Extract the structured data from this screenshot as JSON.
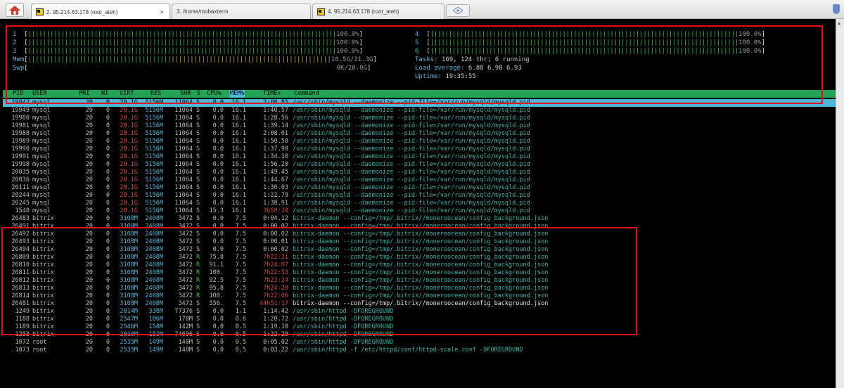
{
  "tabs": [
    {
      "label": "2. 95.214.63.178 (root_ateh)",
      "active": true,
      "has_close": true
    },
    {
      "label": "3. /home/mobaxterm",
      "active": false
    },
    {
      "label": "4. 95.214.63.178 (root_ateh)",
      "active": false
    }
  ],
  "tab_close": "×",
  "cpu_meters": [
    {
      "id": "1",
      "pct": "100.0%"
    },
    {
      "id": "2",
      "pct": "100.0%"
    },
    {
      "id": "3",
      "pct": "100.0%"
    },
    {
      "id": "4",
      "pct": "100.0%"
    },
    {
      "id": "5",
      "pct": "100.0%"
    },
    {
      "id": "6",
      "pct": "100.0%"
    }
  ],
  "mem": {
    "label": "Mem",
    "value": "10.5G/31.3G"
  },
  "swp": {
    "label": "Swp",
    "value": "0K/20.0G"
  },
  "tasks": {
    "label": "Tasks:",
    "text": "169, 124 thr; 6 running"
  },
  "load": {
    "label": "Load average:",
    "text": "6.88 6.98 6.93"
  },
  "uptime": {
    "label": "Uptime:",
    "text": "19:35:55"
  },
  "columns": {
    "pid": "PID",
    "user": "USER",
    "pri": "PRI",
    "ni": "NI",
    "virt": "VIRT",
    "res": "RES",
    "shr": "SHR",
    "s": "S",
    "cpu": "CPU%",
    "mem": "MEM%",
    "time": "TIME+",
    "cmd": "Command"
  },
  "processes": [
    {
      "pid": "19942",
      "user": "mysql",
      "pri": "20",
      "ni": "0",
      "virt": "20.1G",
      "res": "5156M",
      "shr": "11064",
      "s": "S",
      "cpu": "0.0",
      "mem": "16.1",
      "time": "2:00.85",
      "cmd": "/usr/sbin/mysqld --daemonize --pid-file=/var/run/mysqld/mysqld.pid"
    },
    {
      "pid": "19949",
      "user": "mysql",
      "pri": "20",
      "ni": "0",
      "virt": "20.1G",
      "res": "5156M",
      "shr": "11064",
      "s": "S",
      "cpu": "0.0",
      "mem": "16.1",
      "time": "1:40.57",
      "cmd": "/usr/sbin/mysqld --daemonize --pid-file=/var/run/mysqld/mysqld.pid"
    },
    {
      "pid": "19980",
      "user": "mysql",
      "pri": "20",
      "ni": "0",
      "virt": "20.1G",
      "res": "5156M",
      "shr": "11064",
      "s": "S",
      "cpu": "0.0",
      "mem": "16.1",
      "time": "1:28.56",
      "cmd": "/usr/sbin/mysqld --daemonize --pid-file=/var/run/mysqld/mysqld.pid"
    },
    {
      "pid": "19981",
      "user": "mysql",
      "pri": "20",
      "ni": "0",
      "virt": "20.1G",
      "res": "5156M",
      "shr": "11064",
      "s": "S",
      "cpu": "0.0",
      "mem": "16.1",
      "time": "1:39.14",
      "cmd": "/usr/sbin/mysqld --daemonize --pid-file=/var/run/mysqld/mysqld.pid"
    },
    {
      "pid": "19988",
      "user": "mysql",
      "pri": "20",
      "ni": "0",
      "virt": "20.1G",
      "res": "5156M",
      "shr": "11064",
      "s": "S",
      "cpu": "0.0",
      "mem": "16.1",
      "time": "2:08.01",
      "cmd": "/usr/sbin/mysqld --daemonize --pid-file=/var/run/mysqld/mysqld.pid"
    },
    {
      "pid": "19989",
      "user": "mysql",
      "pri": "20",
      "ni": "0",
      "virt": "20.1G",
      "res": "5156M",
      "shr": "11064",
      "s": "S",
      "cpu": "0.0",
      "mem": "16.1",
      "time": "1:50.58",
      "cmd": "/usr/sbin/mysqld --daemonize --pid-file=/var/run/mysqld/mysqld.pid"
    },
    {
      "pid": "19990",
      "user": "mysql",
      "pri": "20",
      "ni": "0",
      "virt": "20.1G",
      "res": "5156M",
      "shr": "11064",
      "s": "S",
      "cpu": "0.0",
      "mem": "16.1",
      "time": "1:37.98",
      "cmd": "/usr/sbin/mysqld --daemonize --pid-file=/var/run/mysqld/mysqld.pid"
    },
    {
      "pid": "19991",
      "user": "mysql",
      "pri": "20",
      "ni": "0",
      "virt": "20.1G",
      "res": "5156M",
      "shr": "11064",
      "s": "S",
      "cpu": "0.0",
      "mem": "16.1",
      "time": "1:34.10",
      "cmd": "/usr/sbin/mysqld --daemonize --pid-file=/var/run/mysqld/mysqld.pid"
    },
    {
      "pid": "19998",
      "user": "mysql",
      "pri": "20",
      "ni": "0",
      "virt": "20.1G",
      "res": "5156M",
      "shr": "11064",
      "s": "S",
      "cpu": "0.0",
      "mem": "16.1",
      "time": "1:56.20",
      "cmd": "/usr/sbin/mysqld --daemonize --pid-file=/var/run/mysqld/mysqld.pid"
    },
    {
      "pid": "20035",
      "user": "mysql",
      "pri": "20",
      "ni": "0",
      "virt": "20.1G",
      "res": "5156M",
      "shr": "11064",
      "s": "S",
      "cpu": "0.0",
      "mem": "16.1",
      "time": "1:49.45",
      "cmd": "/usr/sbin/mysqld --daemonize --pid-file=/var/run/mysqld/mysqld.pid"
    },
    {
      "pid": "20036",
      "user": "mysql",
      "pri": "20",
      "ni": "0",
      "virt": "20.1G",
      "res": "5156M",
      "shr": "11064",
      "s": "S",
      "cpu": "0.0",
      "mem": "16.1",
      "time": "1:44.67",
      "cmd": "/usr/sbin/mysqld --daemonize --pid-file=/var/run/mysqld/mysqld.pid"
    },
    {
      "pid": "20111",
      "user": "mysql",
      "pri": "20",
      "ni": "0",
      "virt": "20.1G",
      "res": "5156M",
      "shr": "11064",
      "s": "S",
      "cpu": "0.0",
      "mem": "16.1",
      "time": "1:30.03",
      "cmd": "/usr/sbin/mysqld --daemonize --pid-file=/var/run/mysqld/mysqld.pid"
    },
    {
      "pid": "20244",
      "user": "mysql",
      "pri": "20",
      "ni": "0",
      "virt": "20.1G",
      "res": "5156M",
      "shr": "11064",
      "s": "S",
      "cpu": "0.0",
      "mem": "16.1",
      "time": "1:22.79",
      "cmd": "/usr/sbin/mysqld --daemonize --pid-file=/var/run/mysqld/mysqld.pid"
    },
    {
      "pid": "20245",
      "user": "mysql",
      "pri": "20",
      "ni": "0",
      "virt": "20.1G",
      "res": "5156M",
      "shr": "11064",
      "s": "S",
      "cpu": "0.0",
      "mem": "16.1",
      "time": "1:38.91",
      "cmd": "/usr/sbin/mysqld --daemonize --pid-file=/var/run/mysqld/mysqld.pid"
    },
    {
      "pid": "1548",
      "user": "mysql",
      "pri": "20",
      "ni": "0",
      "virt": "20.1G",
      "res": "5156M",
      "shr": "11064",
      "s": "S",
      "cpu": "15.3",
      "mem": "16.1",
      "time": "3h58:18",
      "cmd": "/usr/sbin/mysqld --daemonize --pid-file=/var/run/mysqld/mysqld.pid"
    },
    {
      "pid": "26483",
      "user": "bitrix",
      "pri": "20",
      "ni": "0",
      "virt": "3108M",
      "res": "2408M",
      "shr": "3472",
      "s": "S",
      "cpu": "0.0",
      "mem": "7.5",
      "time": "0:04.12",
      "cmd": "bitrix-daemon --config=/tmp/.bitrix//moneroocean/config_background.json"
    },
    {
      "pid": "26491",
      "user": "bitrix",
      "pri": "20",
      "ni": "0",
      "virt": "3108M",
      "res": "2408M",
      "shr": "3472",
      "s": "S",
      "cpu": "0.0",
      "mem": "7.5",
      "time": "0:00.02",
      "cmd": "bitrix-daemon --config=/tmp/.bitrix//moneroocean/config_background.json"
    },
    {
      "pid": "26492",
      "user": "bitrix",
      "pri": "20",
      "ni": "0",
      "virt": "3108M",
      "res": "2408M",
      "shr": "3472",
      "s": "S",
      "cpu": "0.0",
      "mem": "7.5",
      "time": "0:00.02",
      "cmd": "bitrix-daemon --config=/tmp/.bitrix//moneroocean/config_background.json"
    },
    {
      "pid": "26493",
      "user": "bitrix",
      "pri": "20",
      "ni": "0",
      "virt": "3108M",
      "res": "2408M",
      "shr": "3472",
      "s": "S",
      "cpu": "0.0",
      "mem": "7.5",
      "time": "0:00.01",
      "cmd": "bitrix-daemon --config=/tmp/.bitrix//moneroocean/config_background.json"
    },
    {
      "pid": "26494",
      "user": "bitrix",
      "pri": "20",
      "ni": "0",
      "virt": "3108M",
      "res": "2408M",
      "shr": "3472",
      "s": "S",
      "cpu": "0.0",
      "mem": "7.5",
      "time": "0:00.02",
      "cmd": "bitrix-daemon --config=/tmp/.bitrix//moneroocean/config_background.json"
    },
    {
      "pid": "26809",
      "user": "bitrix",
      "pri": "20",
      "ni": "0",
      "virt": "3108M",
      "res": "2408M",
      "shr": "3472",
      "s": "R",
      "cpu": "75.8",
      "mem": "7.5",
      "time": "7h22:31",
      "cmd": "bitrix-daemon --config=/tmp/.bitrix//moneroocean/config_background.json"
    },
    {
      "pid": "26810",
      "user": "bitrix",
      "pri": "20",
      "ni": "0",
      "virt": "3108M",
      "res": "2408M",
      "shr": "3472",
      "s": "R",
      "cpu": "91.1",
      "mem": "7.5",
      "time": "7h24:07",
      "cmd": "bitrix-daemon --config=/tmp/.bitrix//moneroocean/config_background.json"
    },
    {
      "pid": "26811",
      "user": "bitrix",
      "pri": "20",
      "ni": "0",
      "virt": "3108M",
      "res": "2408M",
      "shr": "3472",
      "s": "R",
      "cpu": "100.",
      "mem": "7.5",
      "time": "7h22:53",
      "cmd": "bitrix-daemon --config=/tmp/.bitrix//moneroocean/config_background.json"
    },
    {
      "pid": "26812",
      "user": "bitrix",
      "pri": "20",
      "ni": "0",
      "virt": "3108M",
      "res": "2408M",
      "shr": "3472",
      "s": "R",
      "cpu": "92.5",
      "mem": "7.5",
      "time": "7h23:24",
      "cmd": "bitrix-daemon --config=/tmp/.bitrix//moneroocean/config_background.json"
    },
    {
      "pid": "26813",
      "user": "bitrix",
      "pri": "20",
      "ni": "0",
      "virt": "3108M",
      "res": "2408M",
      "shr": "3472",
      "s": "R",
      "cpu": "95.8",
      "mem": "7.5",
      "time": "7h24:20",
      "cmd": "bitrix-daemon --config=/tmp/.bitrix//moneroocean/config_background.json"
    },
    {
      "pid": "26814",
      "user": "bitrix",
      "pri": "20",
      "ni": "0",
      "virt": "3108M",
      "res": "2408M",
      "shr": "3472",
      "s": "R",
      "cpu": "100.",
      "mem": "7.5",
      "time": "7h22:06",
      "cmd": "bitrix-daemon --config=/tmp/.bitrix//moneroocean/config_background.json"
    },
    {
      "pid": "26481",
      "user": "bitrix",
      "pri": "20",
      "ni": "0",
      "virt": "3108M",
      "res": "2408M",
      "shr": "3472",
      "s": "S",
      "cpu": "556.",
      "mem": "7.5",
      "time": "44h51:17",
      "cmd": "bitrix-daemon --config=/tmp/.bitrix//moneroocean/config_background.json"
    },
    {
      "pid": "1249",
      "user": "bitrix",
      "pri": "20",
      "ni": "0",
      "virt": "2814M",
      "res": "338M",
      "shr": "77376",
      "s": "S",
      "cpu": "0.0",
      "mem": "1.1",
      "time": "1:14.42",
      "cmd": "/usr/sbin/httpd -DFOREGROUND"
    },
    {
      "pid": "1188",
      "user": "bitrix",
      "pri": "20",
      "ni": "0",
      "virt": "2547M",
      "res": "186M",
      "shr": "170M",
      "s": "S",
      "cpu": "0.0",
      "mem": "0.6",
      "time": "1:20.72",
      "cmd": "/usr/sbin/httpd -DFOREGROUND"
    },
    {
      "pid": "1189",
      "user": "bitrix",
      "pri": "20",
      "ni": "0",
      "virt": "2546M",
      "res": "158M",
      "shr": "142M",
      "s": "S",
      "cpu": "0.0",
      "mem": "0.5",
      "time": "1:19.10",
      "cmd": "/usr/sbin/httpd -DFOREGROUND"
    },
    {
      "pid": "1253",
      "user": "bitrix",
      "pri": "20",
      "ni": "0",
      "virt": "2010M",
      "res": "152M",
      "shr": "74696",
      "s": "S",
      "cpu": "0.0",
      "mem": "0.5",
      "time": "1:22.29",
      "cmd": "/usr/sbin/httpd -DFOREGROUND"
    },
    {
      "pid": "1072",
      "user": "root",
      "pri": "20",
      "ni": "0",
      "virt": "2535M",
      "res": "149M",
      "shr": "140M",
      "s": "S",
      "cpu": "0.0",
      "mem": "0.5",
      "time": "0:05.02",
      "cmd": "/usr/sbin/httpd -DFOREGROUND"
    },
    {
      "pid": "1073",
      "user": "root",
      "pri": "20",
      "ni": "0",
      "virt": "2535M",
      "res": "149M",
      "shr": "140M",
      "s": "S",
      "cpu": "0.0",
      "mem": "0.5",
      "time": "0:03.22",
      "cmd": "/usr/sbin/httpd -f /etc/httpd/conf/httpd-scale.conf -DFOREGROUND"
    }
  ],
  "colors": {
    "header_green": "#23a356",
    "selection_cyan": "#4fb8d9",
    "meter_green": "#36c23a",
    "alert_red": "#e01010"
  }
}
